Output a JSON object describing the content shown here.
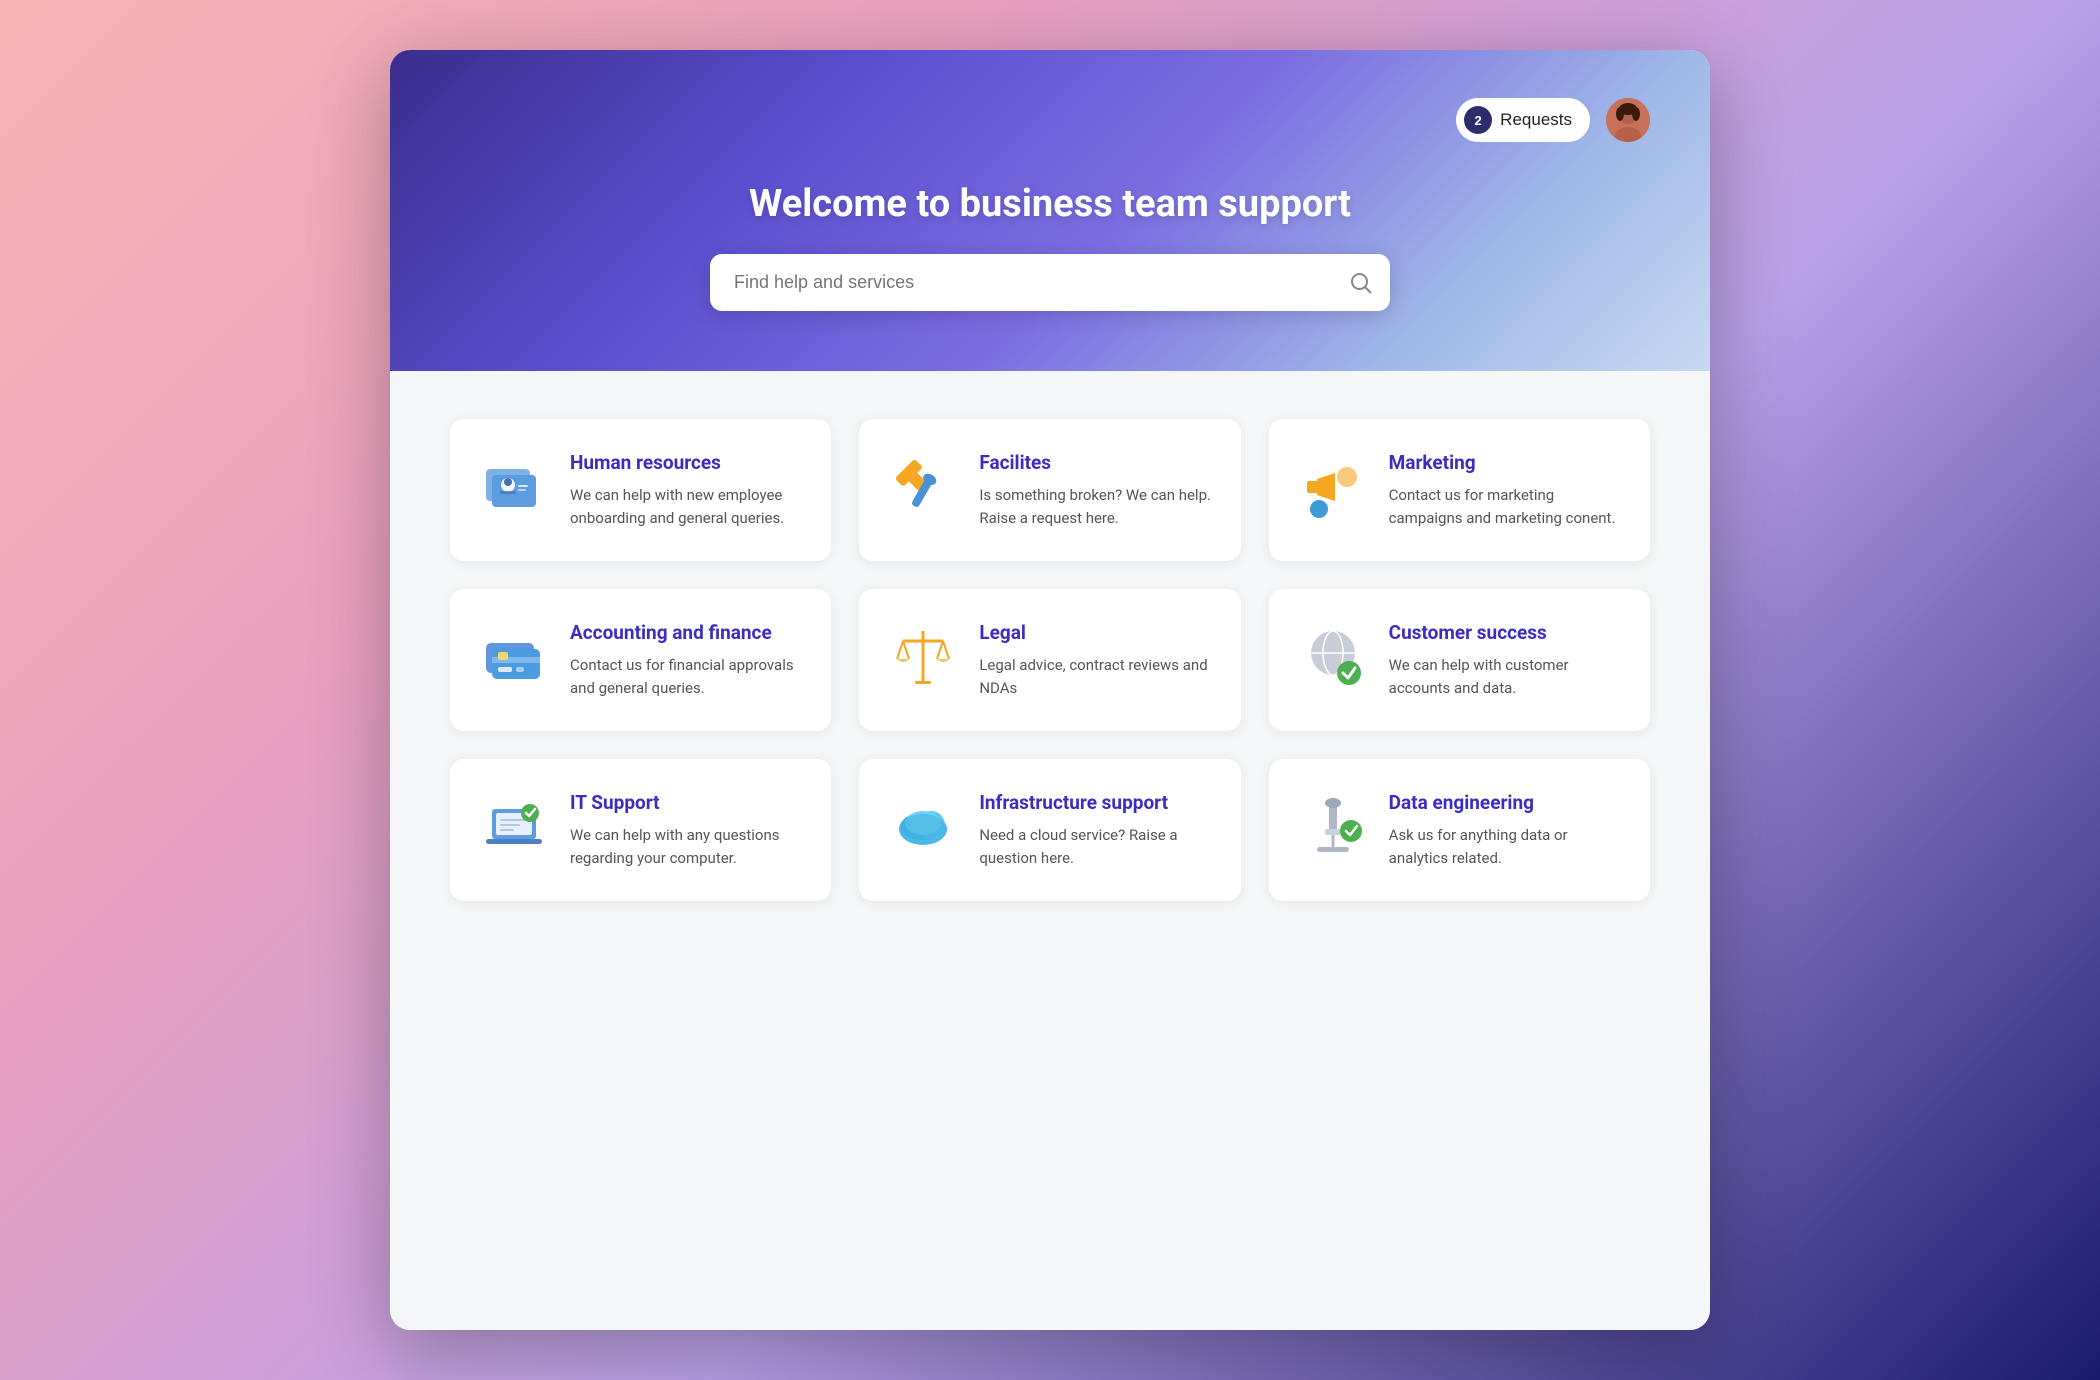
{
  "hero": {
    "title": "Welcome to business team support",
    "search_placeholder": "Find help and services",
    "requests_label": "Requests",
    "requests_count": "2"
  },
  "cards": [
    {
      "id": "human-resources",
      "title": "Human resources",
      "description": "We can help with new employee onboarding and general queries.",
      "icon": "hr"
    },
    {
      "id": "facilities",
      "title": "Facilites",
      "description": "Is something broken? We can help. Raise a request here.",
      "icon": "tools"
    },
    {
      "id": "marketing",
      "title": "Marketing",
      "description": "Contact us for marketing campaigns and marketing conent.",
      "icon": "megaphone"
    },
    {
      "id": "accounting-finance",
      "title": "Accounting and finance",
      "description": "Contact us for financial approvals and general queries.",
      "icon": "card"
    },
    {
      "id": "legal",
      "title": "Legal",
      "description": "Legal advice, contract reviews and NDAs",
      "icon": "scales"
    },
    {
      "id": "customer-success",
      "title": "Customer success",
      "description": "We can help with customer accounts and data.",
      "icon": "customer"
    },
    {
      "id": "it-support",
      "title": "IT Support",
      "description": "We can help with any questions regarding your computer.",
      "icon": "laptop"
    },
    {
      "id": "infrastructure-support",
      "title": "Infrastructure support",
      "description": "Need a cloud service? Raise a question here.",
      "icon": "cloud"
    },
    {
      "id": "data-engineering",
      "title": "Data engineering",
      "description": "Ask us for anything data or analytics related.",
      "icon": "microscope"
    }
  ]
}
